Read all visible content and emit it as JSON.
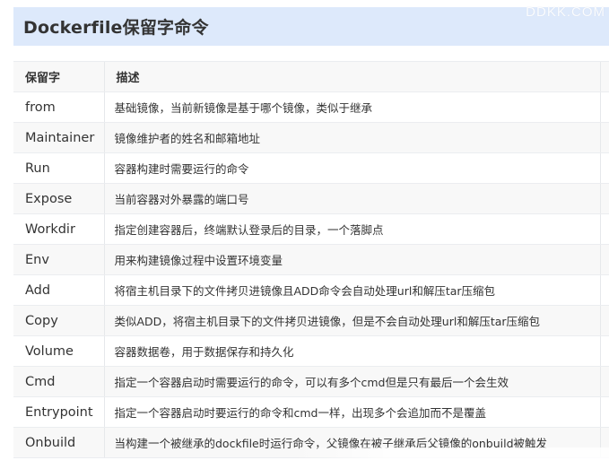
{
  "title": "Dockerfile保留字命令",
  "watermark": "DDKK.COM",
  "table": {
    "headers": {
      "keyword": "保留字",
      "description": "描述"
    },
    "rows": [
      {
        "keyword": "from",
        "description": "基础镜像，当前新镜像是基于哪个镜像，类似于继承"
      },
      {
        "keyword": "Maintainer",
        "description": "镜像维护者的姓名和邮箱地址"
      },
      {
        "keyword": "Run",
        "description": "容器构建时需要运行的命令"
      },
      {
        "keyword": "Expose",
        "description": "当前容器对外暴露的端口号"
      },
      {
        "keyword": "Workdir",
        "description": "指定创建容器后，终端默认登录后的目录，一个落脚点"
      },
      {
        "keyword": "Env",
        "description": "用来构建镜像过程中设置环境变量"
      },
      {
        "keyword": "Add",
        "description": "将宿主机目录下的文件拷贝进镜像且ADD命令会自动处理url和解压tar压缩包"
      },
      {
        "keyword": "Copy",
        "description": "类似ADD，将宿主机目录下的文件拷贝进镜像，但是不会自动处理url和解压tar压缩包"
      },
      {
        "keyword": "Volume",
        "description": "容器数据卷，用于数据保存和持久化"
      },
      {
        "keyword": "Cmd",
        "description": "指定一个容器启动时需要运行的命令，可以有多个cmd但是只有最后一个会生效"
      },
      {
        "keyword": "Entrypoint",
        "description": "指定一个容器启动时要运行的命令和cmd一样，出现多个会追加而不是覆盖"
      },
      {
        "keyword": "Onbuild",
        "description": "当构建一个被继承的dockfile时运行命令，父镜像在被子继承后父镜像的onbuild被触发"
      }
    ]
  }
}
